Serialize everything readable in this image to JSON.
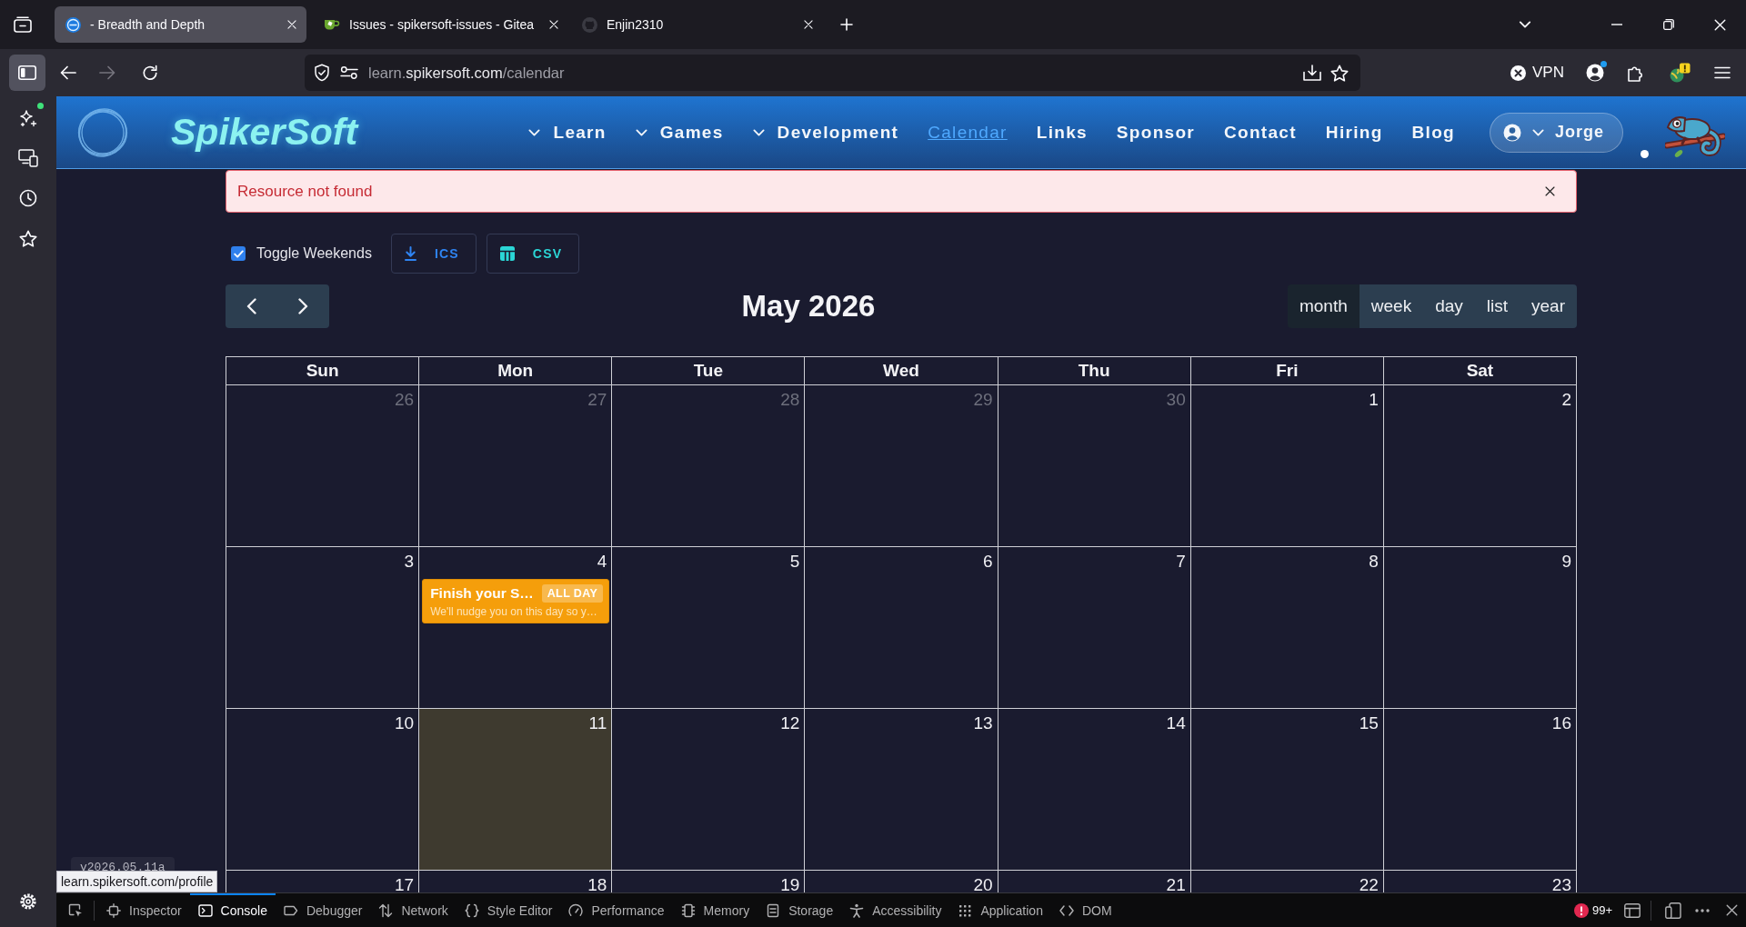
{
  "browser": {
    "tabs": [
      {
        "title": "- Breadth and Depth",
        "kind": "site",
        "selected": true
      },
      {
        "title": "Issues - spikersoft-issues - Gitea",
        "kind": "gitea",
        "selected": false
      },
      {
        "title": "Enjin2310",
        "kind": "github",
        "selected": false
      }
    ],
    "forward_disabled": true,
    "url": {
      "subdomain": "learn.",
      "domain": "spikersoft.com",
      "path": "/calendar"
    },
    "vpn": "VPN",
    "status_link": "learn.spikersoft.com/profile"
  },
  "site": {
    "brand": "SpikerSoft",
    "nav": [
      {
        "label": "Learn",
        "dropdown": true,
        "current": false
      },
      {
        "label": "Games",
        "dropdown": true,
        "current": false
      },
      {
        "label": "Development",
        "dropdown": true,
        "current": false
      },
      {
        "label": "Calendar",
        "dropdown": false,
        "current": true
      },
      {
        "label": "Links",
        "dropdown": false,
        "current": false
      },
      {
        "label": "Sponsor",
        "dropdown": false,
        "current": false
      },
      {
        "label": "Contact",
        "dropdown": false,
        "current": false
      },
      {
        "label": "Hiring",
        "dropdown": false,
        "current": false
      },
      {
        "label": "Blog",
        "dropdown": false,
        "current": false
      }
    ],
    "user": "Jorge",
    "alert": "Resource not found",
    "version": "v2026.05.11a"
  },
  "calendar": {
    "toggle_weekends": {
      "label": "Toggle Weekends",
      "checked": true
    },
    "exports": [
      {
        "label": "ICS",
        "kind": "download"
      },
      {
        "label": "CSV",
        "kind": "table"
      }
    ],
    "title": "May 2026",
    "views": [
      {
        "label": "month",
        "selected": true
      },
      {
        "label": "week",
        "selected": false
      },
      {
        "label": "day",
        "selected": false
      },
      {
        "label": "list",
        "selected": false
      },
      {
        "label": "year",
        "selected": false
      }
    ],
    "weekdays": [
      "Sun",
      "Mon",
      "Tue",
      "Wed",
      "Thu",
      "Fri",
      "Sat"
    ],
    "weeks": [
      {
        "days": [
          {
            "date": "26",
            "other_month": true,
            "today": false
          },
          {
            "date": "27",
            "other_month": true,
            "today": false
          },
          {
            "date": "28",
            "other_month": true,
            "today": false
          },
          {
            "date": "29",
            "other_month": true,
            "today": false
          },
          {
            "date": "30",
            "other_month": true,
            "today": false
          },
          {
            "date": "1",
            "other_month": false,
            "today": false
          },
          {
            "date": "2",
            "other_month": false,
            "today": false
          }
        ]
      },
      {
        "days": [
          {
            "date": "3",
            "other_month": false,
            "today": false
          },
          {
            "date": "4",
            "other_month": false,
            "today": false,
            "events": [
              {
                "title": "Finish your S…",
                "badge": "ALL DAY",
                "note": "We'll nudge you on this day so y…"
              }
            ]
          },
          {
            "date": "5",
            "other_month": false,
            "today": false
          },
          {
            "date": "6",
            "other_month": false,
            "today": false
          },
          {
            "date": "7",
            "other_month": false,
            "today": false
          },
          {
            "date": "8",
            "other_month": false,
            "today": false
          },
          {
            "date": "9",
            "other_month": false,
            "today": false
          }
        ]
      },
      {
        "days": [
          {
            "date": "10",
            "other_month": false,
            "today": false
          },
          {
            "date": "11",
            "other_month": false,
            "today": true
          },
          {
            "date": "12",
            "other_month": false,
            "today": false
          },
          {
            "date": "13",
            "other_month": false,
            "today": false
          },
          {
            "date": "14",
            "other_month": false,
            "today": false
          },
          {
            "date": "15",
            "other_month": false,
            "today": false
          },
          {
            "date": "16",
            "other_month": false,
            "today": false
          }
        ]
      },
      {
        "days": [
          {
            "date": "17",
            "other_month": false,
            "today": false
          },
          {
            "date": "18",
            "other_month": false,
            "today": false
          },
          {
            "date": "19",
            "other_month": false,
            "today": false
          },
          {
            "date": "20",
            "other_month": false,
            "today": false
          },
          {
            "date": "21",
            "other_month": false,
            "today": false
          },
          {
            "date": "22",
            "other_month": false,
            "today": false
          },
          {
            "date": "23",
            "other_month": false,
            "today": false
          }
        ]
      }
    ]
  },
  "devtools": {
    "tabs": [
      {
        "label": "Inspector",
        "kind": "inspector",
        "selected": false
      },
      {
        "label": "Console",
        "kind": "console",
        "selected": true
      },
      {
        "label": "Debugger",
        "kind": "debugger",
        "selected": false
      },
      {
        "label": "Network",
        "kind": "network",
        "selected": false
      },
      {
        "label": "Style Editor",
        "kind": "style",
        "selected": false
      },
      {
        "label": "Performance",
        "kind": "performance",
        "selected": false
      },
      {
        "label": "Memory",
        "kind": "memory",
        "selected": false
      },
      {
        "label": "Storage",
        "kind": "storage",
        "selected": false
      },
      {
        "label": "Accessibility",
        "kind": "accessibility",
        "selected": false
      },
      {
        "label": "Application",
        "kind": "application",
        "selected": false
      },
      {
        "label": "DOM",
        "kind": "dom",
        "selected": false
      }
    ],
    "error_count": "99+"
  }
}
